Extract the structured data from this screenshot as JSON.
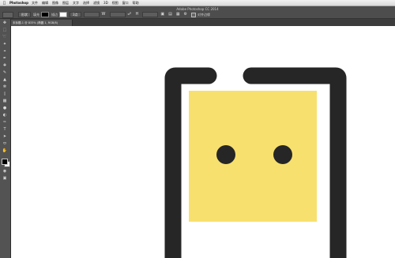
{
  "menubar": {
    "app_name": "Photoshop",
    "items": [
      "文件",
      "编辑",
      "图像",
      "图层",
      "文字",
      "选择",
      "滤镜",
      "3D",
      "视图",
      "窗口",
      "帮助"
    ]
  },
  "window": {
    "title": "Adobe Photoshop CC 2014"
  },
  "options_bar": {
    "shape_mode": "形状",
    "fill_label": "填充",
    "stroke_label": "描边",
    "stroke_width": "3点",
    "align_edges_label": "对齐边缘"
  },
  "document_tab": {
    "label": "未标题-1 @ 833% (椭圆 1, RGB/8)"
  },
  "colors": {
    "frame": "#262626",
    "screen": "#f7e06e",
    "eye": "#262626",
    "canvas": "#ffffff",
    "ui_dark": "#535353"
  }
}
